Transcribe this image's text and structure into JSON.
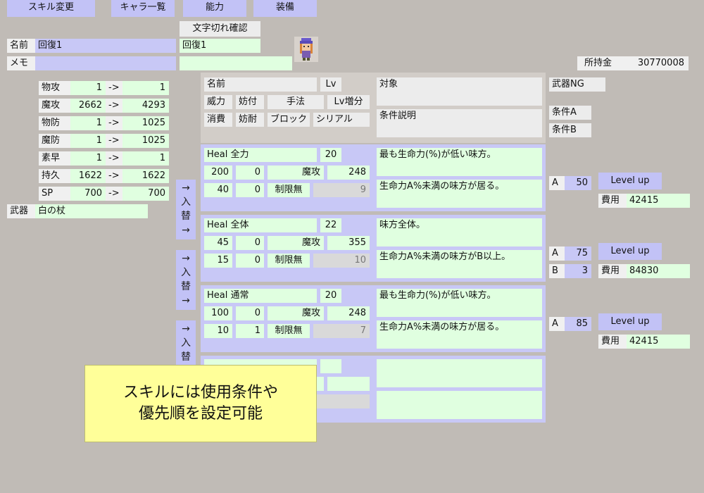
{
  "tabs": {
    "skill_change": "スキル変更",
    "char_list": "キャラ一覧",
    "ability": "能力",
    "equipment": "装備"
  },
  "text_check_button": "文字切れ確認",
  "name_field": {
    "label": "名前",
    "value": "回復1",
    "check_value": "回復1"
  },
  "memo_field": {
    "label": "メモ",
    "value": ""
  },
  "money": {
    "label": "所持金",
    "value": "30770008"
  },
  "stats": [
    {
      "label": "物攻",
      "from": "1",
      "arrow": "->",
      "to": "1"
    },
    {
      "label": "魔攻",
      "from": "2662",
      "arrow": "->",
      "to": "4293"
    },
    {
      "label": "物防",
      "from": "1",
      "arrow": "->",
      "to": "1025"
    },
    {
      "label": "魔防",
      "from": "1",
      "arrow": "->",
      "to": "1025"
    },
    {
      "label": "素早",
      "from": "1",
      "arrow": "->",
      "to": "1"
    },
    {
      "label": "持久",
      "from": "1622",
      "arrow": "->",
      "to": "1622"
    },
    {
      "label": "SP",
      "from": "700",
      "arrow": "->",
      "to": "700"
    }
  ],
  "weapon": {
    "label": "武器",
    "value": "白の杖"
  },
  "header": {
    "name": "名前",
    "lv": "Lv",
    "power": "威力",
    "interfere": "妨付",
    "method": "手法",
    "lv_increase": "Lv増分",
    "consume": "消費",
    "resist": "妨耐",
    "block": "ブロック",
    "serial": "シリアル",
    "target": "対象",
    "condition_desc": "条件説明",
    "weapon_ng": "武器NG",
    "cond_a": "条件A",
    "cond_b": "条件B"
  },
  "swap_button": {
    "arrow_top": "→",
    "char1": "入",
    "char2": "替",
    "arrow_bottom": "→"
  },
  "skills": [
    {
      "name": "Heal 全力",
      "lv": "20",
      "power": "200",
      "interfere": "0",
      "method": "魔攻",
      "lv_increase": "248",
      "consume": "40",
      "resist": "0",
      "block": "制限無",
      "serial": "9",
      "target": "最も生命力(%)が低い味方。",
      "condition": "生命力A%未満の味方が居る。",
      "params": [
        {
          "key": "A",
          "value": "50"
        }
      ],
      "levelup": "Level up",
      "cost_label": "費用",
      "cost": "42415"
    },
    {
      "name": "Heal 全体",
      "lv": "22",
      "power": "45",
      "interfere": "0",
      "method": "魔攻",
      "lv_increase": "355",
      "consume": "15",
      "resist": "0",
      "block": "制限無",
      "serial": "10",
      "target": "味方全体。",
      "condition": "生命力A%未満の味方がB以上。",
      "params": [
        {
          "key": "A",
          "value": "75"
        },
        {
          "key": "B",
          "value": "3"
        }
      ],
      "levelup": "Level up",
      "cost_label": "費用",
      "cost": "84830"
    },
    {
      "name": "Heal 通常",
      "lv": "20",
      "power": "100",
      "interfere": "0",
      "method": "魔攻",
      "lv_increase": "248",
      "consume": "10",
      "resist": "1",
      "block": "制限無",
      "serial": "7",
      "target": "最も生命力(%)が低い味方。",
      "condition": "生命力A%未満の味方が居る。",
      "params": [
        {
          "key": "A",
          "value": "85"
        }
      ],
      "levelup": "Level up",
      "cost_label": "費用",
      "cost": "42415"
    }
  ],
  "caption": {
    "line1": "スキルには使用条件や",
    "line2": "優先順を設定可能"
  },
  "colors": {
    "background": "#c0bbb6",
    "tab": "#c2c2f6",
    "field_green": "#e0ffe0",
    "field_purple": "#c8c8f6",
    "caption_yellow": "#ffff99"
  }
}
